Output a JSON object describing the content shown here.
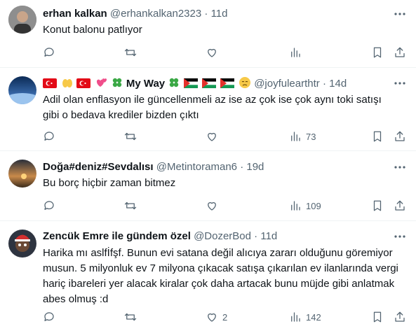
{
  "tweets": [
    {
      "name": "erhan kalkan",
      "handle": "@erhankalkan2323",
      "dot": "·",
      "time": "11d",
      "text": "Konut balonu patlıyor",
      "replies": "",
      "reposts": "",
      "likes": "",
      "views": ""
    },
    {
      "name": "My Way",
      "handle": "@joyfulearthtr",
      "dot": "·",
      "time": "14d",
      "text": "Adil olan enflasyon ile güncellenmeli az ise az çok ise çok aynı toki satışı gibi o bedava krediler bizden çıktı",
      "replies": "",
      "reposts": "",
      "likes": "",
      "views": "73"
    },
    {
      "name": "Doğa#deniz#Sevdalısı",
      "handle": "@Metintoraman6",
      "dot": "·",
      "time": "19d",
      "text": "Bu borç hiçbir zaman bitmez",
      "replies": "",
      "reposts": "",
      "likes": "",
      "views": "109"
    },
    {
      "name": "Zencük Emre ile gündem özel",
      "handle": "@DozerBod",
      "dot": "·",
      "time": "11d",
      "text": "Harika mı aslfİfşf. Bunun evi satana değil alıcıya zararı olduğunu göremiyor musun. 5 milyonluk ev 7 milyona çıkacak satışa çıkarılan ev ilanlarında vergi hariç ibareleri yer alacak kiralar çok daha artacak bunu müjde gibi anlatmak abes olmuş :d",
      "replies": "",
      "reposts": "",
      "likes": "2",
      "views": "142"
    }
  ],
  "icons": [
    "reply-icon",
    "repost-icon",
    "like-icon",
    "views-icon",
    "bookmark-icon",
    "share-icon",
    "more-icon"
  ],
  "colors": {
    "text": "#0f1419",
    "muted": "#536471",
    "divider": "#eff3f4",
    "flag_red": "#e30a17"
  }
}
